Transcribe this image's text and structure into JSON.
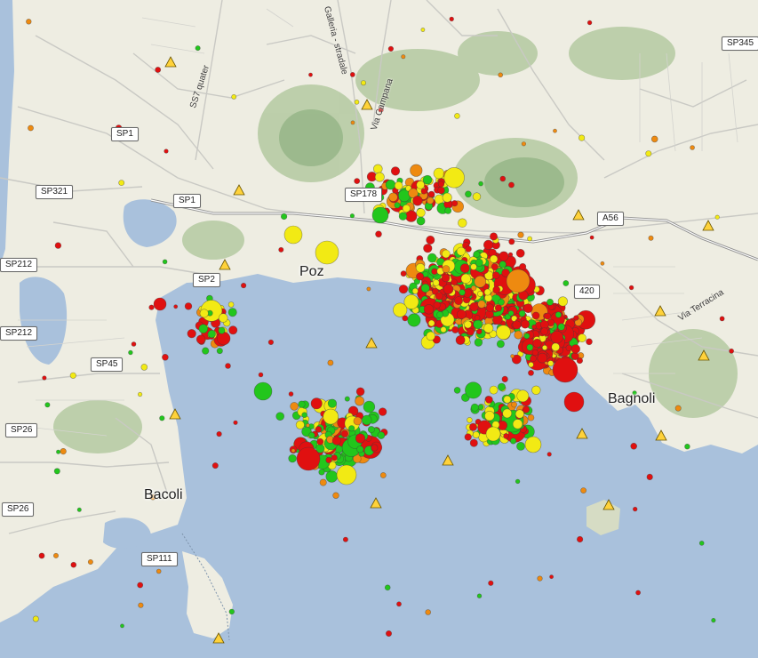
{
  "map": {
    "places": {
      "pozzuoli": "Poz",
      "bagnoli": "Bagnoli",
      "bacoli": "Bacoli"
    },
    "road_shields": {
      "sp345": "SP345",
      "sp1_north": "SP1",
      "sp321": "SP321",
      "sp1_west": "SP1",
      "sp178": "SP178",
      "a56": "A56",
      "sp212_top": "SP212",
      "sp2": "SP2",
      "sp212_bottom": "SP212",
      "sp45": "SP45",
      "sp26_top": "SP26",
      "sp26_bottom": "SP26",
      "sp111": "SP111",
      "ss7_420": "420"
    },
    "road_names": {
      "galleria": "Galleria - stradale",
      "via_campana": "Via Campana",
      "ss7_quater": "SS7 quater",
      "via_terracina": "Via Terracina"
    },
    "colors": {
      "sea": "#a9c1dc",
      "land": "#eeeee4",
      "green_relief": "#a8c49a",
      "marker_red": "#e01010",
      "marker_orange": "#ee8a10",
      "marker_yellow": "#f2ea14",
      "marker_green": "#22c61c",
      "station_triangle": "#ffd23a"
    },
    "marker_icon": "earthquake-circle",
    "station_icon": "seismic-station-triangle"
  }
}
